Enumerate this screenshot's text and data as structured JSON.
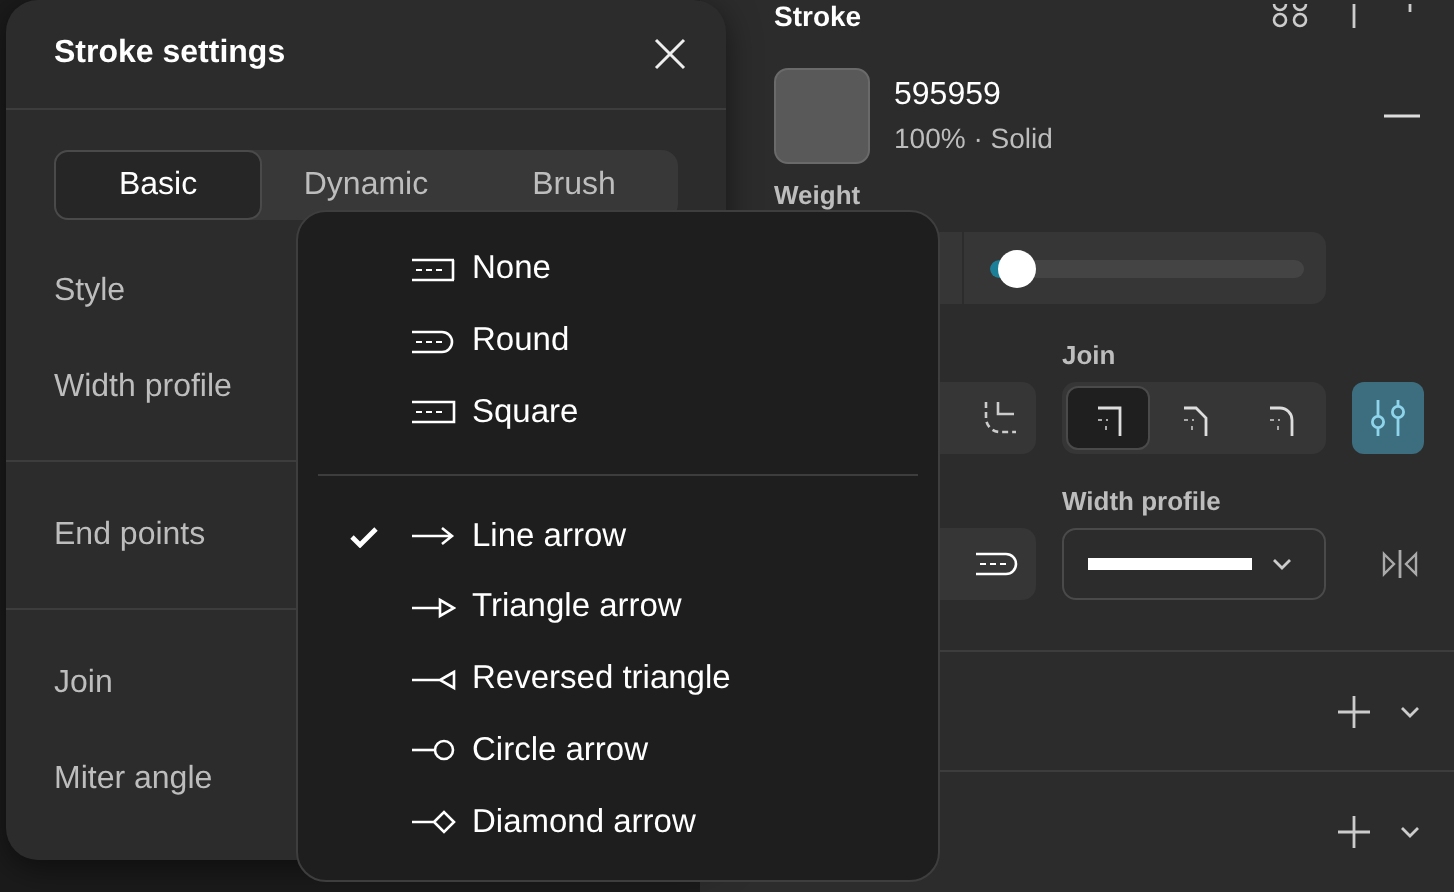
{
  "panel": {
    "title": "Stroke",
    "fill": {
      "hex": "595959",
      "color": "#595959",
      "detail": "100% · Solid"
    },
    "weight": {
      "label": "Weight",
      "level": 0.08
    },
    "join": {
      "label": "Join",
      "options": [
        {
          "kind": "miter",
          "selected": true
        },
        {
          "kind": "bevel",
          "selected": false
        },
        {
          "kind": "round",
          "selected": false
        }
      ]
    },
    "advanced_on": true,
    "width_profile": {
      "label": "Width profile"
    },
    "sections": [
      {
        "expanded": false
      },
      {
        "expanded": false
      }
    ]
  },
  "dialog": {
    "title": "Stroke settings",
    "tabs": [
      {
        "label": "Basic",
        "selected": true
      },
      {
        "label": "Dynamic",
        "selected": false
      },
      {
        "label": "Brush",
        "selected": false
      }
    ],
    "sections": [
      [
        "Style",
        "Width profile"
      ],
      [
        "End points"
      ],
      [
        "Join",
        "Miter angle"
      ]
    ]
  },
  "menu": {
    "groups": [
      [
        {
          "kind": "none",
          "label": "None",
          "selected": false
        },
        {
          "kind": "round",
          "label": "Round",
          "selected": false
        },
        {
          "kind": "square",
          "label": "Square",
          "selected": false
        }
      ],
      [
        {
          "kind": "line-arrow",
          "label": "Line arrow",
          "selected": true
        },
        {
          "kind": "triangle-arrow",
          "label": "Triangle arrow",
          "selected": false
        },
        {
          "kind": "reversed-triangle",
          "label": "Reversed triangle",
          "selected": false
        },
        {
          "kind": "circle-arrow",
          "label": "Circle arrow",
          "selected": false
        },
        {
          "kind": "diamond-arrow",
          "label": "Diamond arrow",
          "selected": false
        }
      ]
    ]
  }
}
